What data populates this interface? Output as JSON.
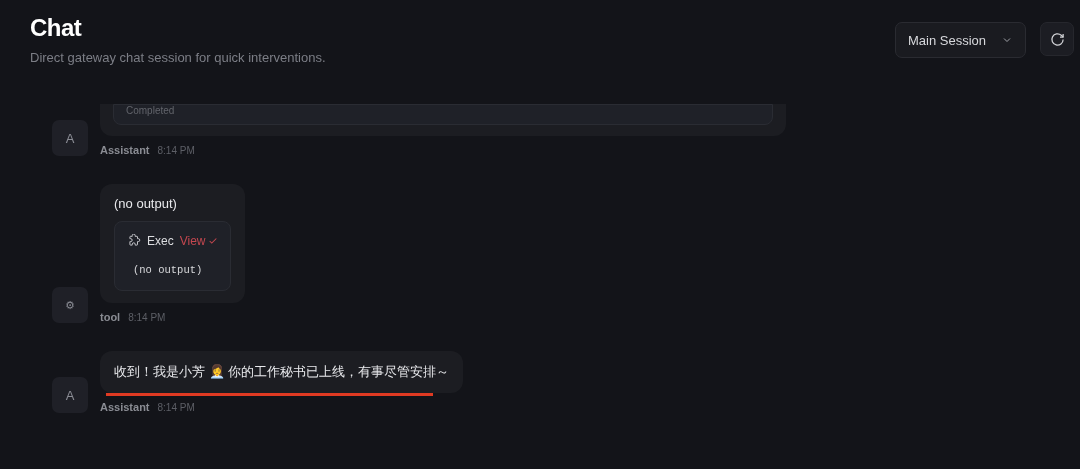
{
  "header": {
    "title": "Chat",
    "subtitle": "Direct gateway chat session for quick interventions."
  },
  "session_select": {
    "value": "Main Session"
  },
  "messages": [
    {
      "avatar": "A",
      "sender": "Assistant",
      "time": "8:14 PM",
      "cut_off": true,
      "tool_card": {
        "status": "Completed"
      }
    },
    {
      "avatar": "⚙",
      "sender": "tool",
      "time": "8:14 PM",
      "cut_off": false,
      "text": "(no output)",
      "tool_card": {
        "name": "Exec",
        "action": "View",
        "done": true,
        "output": "(no output)"
      }
    },
    {
      "avatar": "A",
      "sender": "Assistant",
      "time": "8:14 PM",
      "cut_off": false,
      "text": "收到！我是小芳 👩‍💼 你的工作秘书已上线，有事尽管安排～",
      "underlined": true
    }
  ]
}
